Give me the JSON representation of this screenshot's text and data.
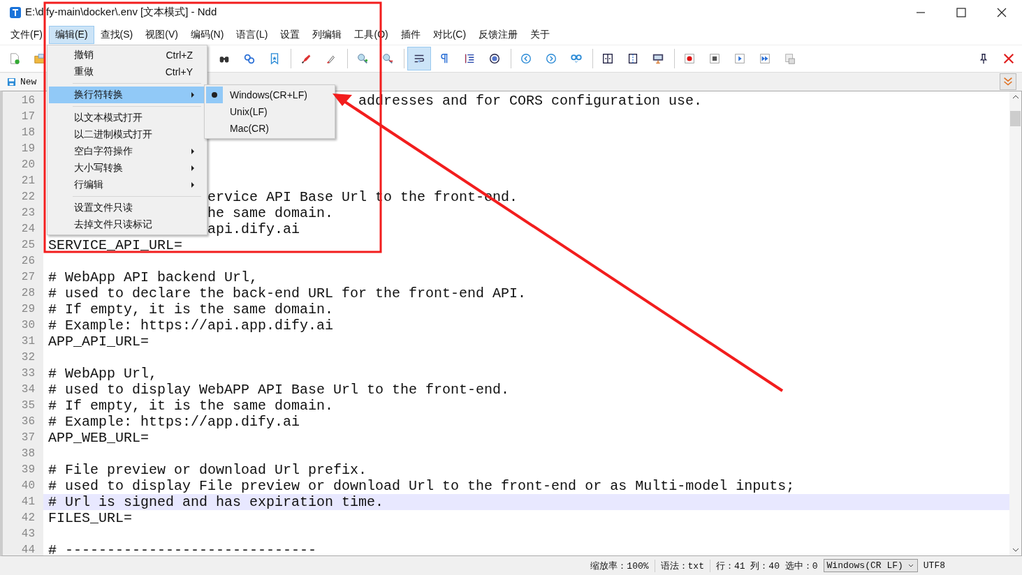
{
  "window": {
    "title": "E:\\dify-main\\docker\\.env [文本模式] - Ndd"
  },
  "menubar": [
    {
      "label": "文件(F)",
      "selected": false
    },
    {
      "label": "编辑(E)",
      "selected": true
    },
    {
      "label": "查找(S)",
      "selected": false
    },
    {
      "label": "视图(V)",
      "selected": false
    },
    {
      "label": "编码(N)",
      "selected": false
    },
    {
      "label": "语言(L)",
      "selected": false
    },
    {
      "label": "设置",
      "selected": false
    },
    {
      "label": "列编辑",
      "selected": false
    },
    {
      "label": "工具(O)",
      "selected": false
    },
    {
      "label": "插件",
      "selected": false
    },
    {
      "label": "对比(C)",
      "selected": false
    },
    {
      "label": "反馈注册",
      "selected": false
    },
    {
      "label": "关于",
      "selected": false
    }
  ],
  "toolbar": {
    "wrap_pressed": true
  },
  "tab": {
    "label": "New"
  },
  "editor": {
    "lines": [
      {
        "num": "16",
        "kind": "after_submenu",
        "text": "addresses and for CORS configuration use.",
        "current": false
      },
      {
        "num": "17",
        "current": false
      },
      {
        "num": "18",
        "current": false
      },
      {
        "num": "19",
        "current": false
      },
      {
        "num": "20",
        "current": false
      },
      {
        "num": "21",
        "current": false
      },
      {
        "num": "22",
        "kind": "after_menu",
        "text": "ervice API Base Url to the front-end.",
        "current": false
      },
      {
        "num": "23",
        "kind": "after_menu",
        "text": "he same domain.",
        "current": false
      },
      {
        "num": "24",
        "kind": "after_menu",
        "text": "api.dify.ai",
        "current": false
      },
      {
        "num": "25",
        "kind": "plain",
        "text": "SERVICE_API_URL=",
        "current": false
      },
      {
        "num": "26",
        "current": false
      },
      {
        "num": "27",
        "kind": "plain",
        "text": "# WebApp API backend Url,",
        "current": false
      },
      {
        "num": "28",
        "kind": "plain",
        "text": "# used to declare the back-end URL for the front-end API.",
        "current": false
      },
      {
        "num": "29",
        "kind": "plain",
        "text": "# If empty, it is the same domain.",
        "current": false
      },
      {
        "num": "30",
        "kind": "plain",
        "text": "# Example: https://api.app.dify.ai",
        "current": false
      },
      {
        "num": "31",
        "kind": "plain",
        "text": "APP_API_URL=",
        "current": false
      },
      {
        "num": "32",
        "current": false
      },
      {
        "num": "33",
        "kind": "plain",
        "text": "# WebApp Url,",
        "current": false
      },
      {
        "num": "34",
        "kind": "plain",
        "text": "# used to display WebAPP API Base Url to the front-end.",
        "current": false
      },
      {
        "num": "35",
        "kind": "plain",
        "text": "# If empty, it is the same domain.",
        "current": false
      },
      {
        "num": "36",
        "kind": "plain",
        "text": "# Example: https://app.dify.ai",
        "current": false
      },
      {
        "num": "37",
        "kind": "plain",
        "text": "APP_WEB_URL=",
        "current": false
      },
      {
        "num": "38",
        "current": false
      },
      {
        "num": "39",
        "kind": "plain",
        "text": "# File preview or download Url prefix.",
        "current": false
      },
      {
        "num": "40",
        "kind": "plain",
        "text": "# used to display File preview or download Url to the front-end or as Multi-model inputs;",
        "current": false
      },
      {
        "num": "41",
        "kind": "plain",
        "text": "# Url is signed and has expiration time.",
        "current": true
      },
      {
        "num": "42",
        "kind": "plain",
        "text": "FILES_URL=",
        "current": false
      },
      {
        "num": "43",
        "current": false
      },
      {
        "num": "44",
        "kind": "plain",
        "text": "# ------------------------------",
        "current": false
      }
    ]
  },
  "edit_menu": {
    "items": [
      {
        "kind": "item",
        "label": "撤销",
        "shortcut": "Ctrl+Z",
        "selected": false
      },
      {
        "kind": "item",
        "label": "重做",
        "shortcut": "Ctrl+Y",
        "selected": false
      },
      {
        "kind": "separator"
      },
      {
        "kind": "submenu",
        "label": "换行符转换",
        "selected": true
      },
      {
        "kind": "separator"
      },
      {
        "kind": "item",
        "label": "以文本模式打开",
        "selected": false
      },
      {
        "kind": "item",
        "label": "以二进制模式打开",
        "selected": false
      },
      {
        "kind": "submenu",
        "label": "空白字符操作",
        "selected": false
      },
      {
        "kind": "submenu",
        "label": "大小写转换",
        "selected": false
      },
      {
        "kind": "submenu",
        "label": "行编辑",
        "selected": false
      },
      {
        "kind": "separator"
      },
      {
        "kind": "item",
        "label": "设置文件只读",
        "selected": false
      },
      {
        "kind": "item",
        "label": "去掉文件只读标记",
        "selected": false
      }
    ]
  },
  "line_ending_submenu": [
    {
      "label": "Windows(CR+LF)",
      "selected": true
    },
    {
      "label": "Unix(LF)",
      "selected": false
    },
    {
      "label": "Mac(CR)",
      "selected": false
    }
  ],
  "status_bar": {
    "zoom": "缩放率：100%",
    "syntax": "语法：txt",
    "position": "行：41 列：40 选中：0",
    "line_ending": "Windows(CR LF)",
    "encoding": "UTF8"
  }
}
